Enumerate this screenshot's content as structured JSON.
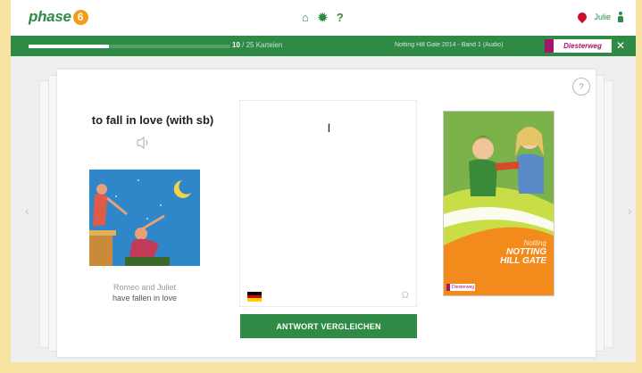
{
  "header": {
    "logo_text": "phase",
    "logo_number": "6",
    "nav": [
      {
        "icon": "home-icon",
        "glyph": "⌂"
      },
      {
        "icon": "gear-icon",
        "glyph": "✹"
      },
      {
        "icon": "help-icon",
        "glyph": "?"
      }
    ],
    "user_name": "Julie"
  },
  "progress": {
    "current": "10",
    "rest": "/ 25 Karteien",
    "fraction": 0.4,
    "book_title": "Notting Hill Gate 2014 - Band 1 (Audio)",
    "publisher": "Diesterweg",
    "close": "✕"
  },
  "card": {
    "question": "to fall in love (with sb)",
    "caption_line1": "Romeo and Juliet",
    "caption_line2": "have fallen in love",
    "answer": "I",
    "special_chars": "Ω",
    "compare_button": "ANTWORT VERGLEICHEN",
    "help": "?",
    "prev_arrow": "‹",
    "next_arrow": "›"
  },
  "cover": {
    "script_line": "Notting",
    "title_line1": "NOTTING",
    "title_line2": "HILL GATE",
    "publisher": "Diesterweg"
  },
  "colors": {
    "brand_green": "#2e8a45",
    "accent_orange": "#f39c1a",
    "publisher_magenta": "#a5156a"
  }
}
